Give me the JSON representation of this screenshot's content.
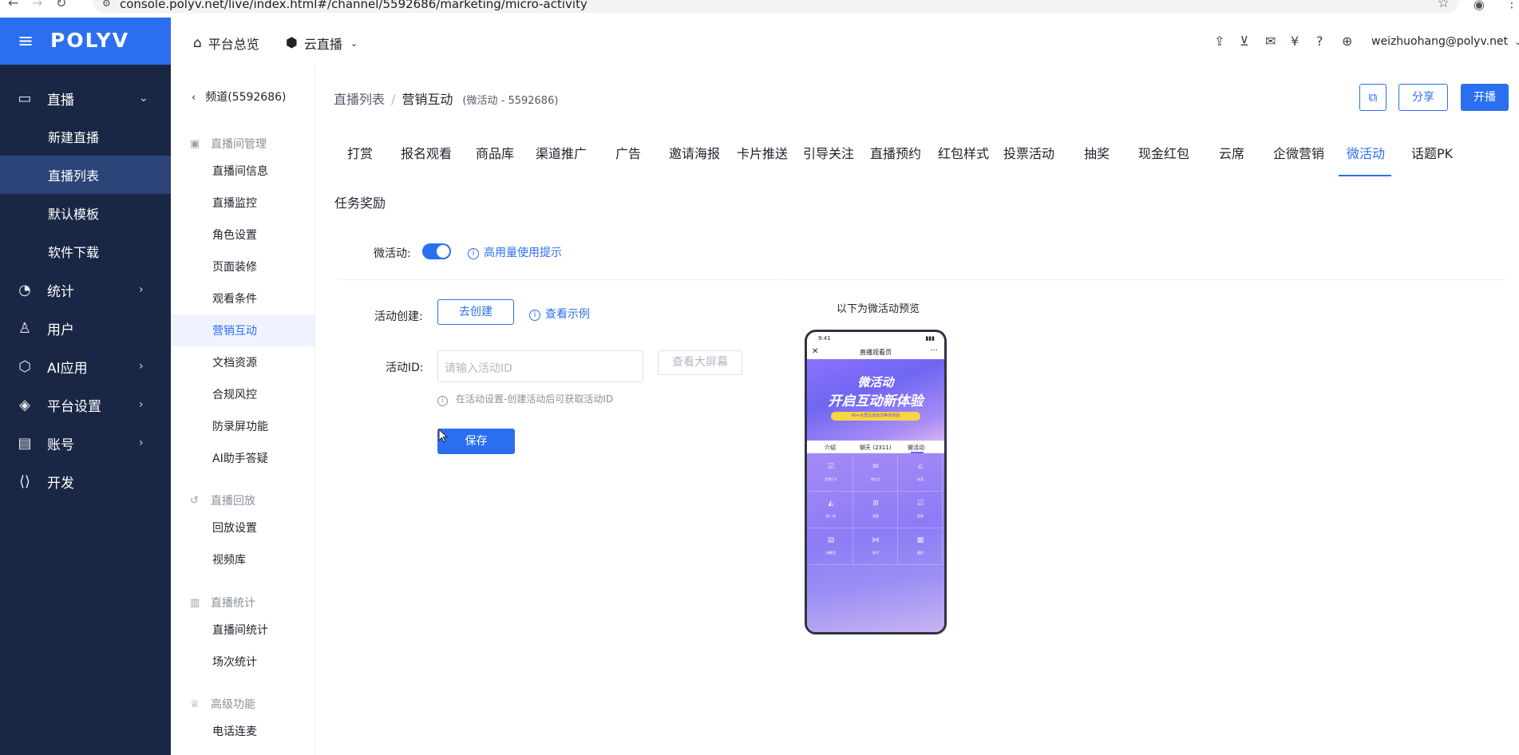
{
  "browser": {
    "url": "console.polyv.net/live/index.html#/channel/5592686/marketing/micro-activity"
  },
  "sidebar": {
    "logo": "POLYV",
    "items": [
      {
        "label": "直播",
        "icon": "video-camera-icon",
        "expanded": true
      },
      {
        "label": "统计",
        "icon": "pie-chart-icon"
      },
      {
        "label": "用户",
        "icon": "user-icon"
      },
      {
        "label": "AI应用",
        "icon": "ai-icon"
      },
      {
        "label": "平台设置",
        "icon": "layers-icon"
      },
      {
        "label": "账号",
        "icon": "id-card-icon"
      },
      {
        "label": "开发",
        "icon": "code-icon"
      }
    ],
    "sub_items": [
      {
        "label": "新建直播"
      },
      {
        "label": "直播列表",
        "active": true
      },
      {
        "label": "默认模板"
      },
      {
        "label": "软件下载"
      }
    ]
  },
  "topbar": {
    "home": "平台总览",
    "product": "云直播",
    "email": "weizhuohang@polyv.net"
  },
  "subsidebar": {
    "channel": "频道(5592686)",
    "groups": [
      {
        "title": "直播间管理",
        "items": [
          "直播间信息",
          "直播监控",
          "角色设置",
          "页面装修",
          "观看条件",
          "营销互动",
          "文档资源",
          "合规风控",
          "防录屏功能",
          "AI助手答疑"
        ]
      },
      {
        "title": "直播回放",
        "items": [
          "回放设置",
          "视频库"
        ]
      },
      {
        "title": "直播统计",
        "items": [
          "直播间统计",
          "场次统计"
        ]
      },
      {
        "title": "高级功能",
        "items": [
          "电话连麦"
        ]
      }
    ],
    "active_item": "营销互动"
  },
  "main": {
    "breadcrumb": {
      "parent": "直播列表",
      "current": "营销互动",
      "meta": "(微活动 - 5592686)"
    },
    "buttons": {
      "share": "分享",
      "start": "开播"
    },
    "tabs": [
      "打赏",
      "报名观看",
      "商品库",
      "渠道推广",
      "广告",
      "邀请海报",
      "卡片推送",
      "引导关注",
      "直播预约",
      "红包样式",
      "投票活动",
      "抽奖",
      "现金红包",
      "云席",
      "企微营销",
      "微活动",
      "话题PK"
    ],
    "active_tab": "微活动",
    "tab_row2": "任务奖励",
    "form": {
      "toggle_label": "微活动:",
      "toggle_on": true,
      "tip_link": "高用量使用提示",
      "create_label": "活动创建:",
      "create_button": "去创建",
      "example_link": "查看示例",
      "id_label": "活动ID:",
      "id_placeholder": "请输入活动ID",
      "id_value": "",
      "big_screen_button": "查看大屏幕",
      "hint": "在活动设置-创建活动后可获取活动ID",
      "save_button": "保存"
    },
    "preview": {
      "title": "以下为微活动预览",
      "phone": {
        "time": "9:41",
        "nav_title": "直播观看页",
        "banner_line1": "微活动",
        "banner_line2": "开启互动新体验",
        "banner_pill": "60+大屏互动玩法等你体验",
        "tabs": [
          "介绍",
          "聊天 (2311)",
          "微活动"
        ],
        "cells": [
          "签到打卡",
          "摇红包",
          "抽奖",
          "摇一摇",
          "答题",
          "投票",
          "弹幕墙",
          "拔河",
          "霸屏"
        ]
      }
    }
  }
}
